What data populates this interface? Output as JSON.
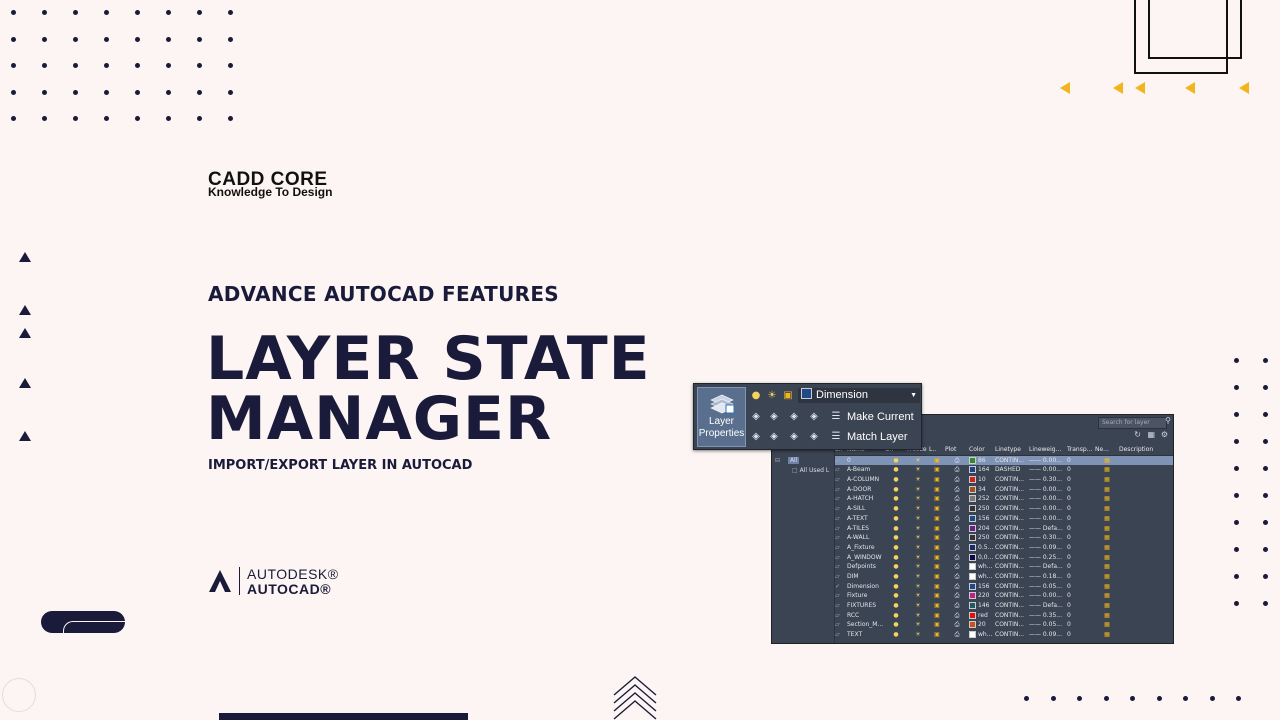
{
  "brand": {
    "name": "CADD CORE",
    "tagline": "Knowledge To Design"
  },
  "headline": {
    "kicker": "ADVANCE AUTOCAD FEATURES",
    "title_line1": "LAYER STATE",
    "title_line2": "MANAGER",
    "subtitle": "IMPORT/EXPORT LAYER IN AUTOCAD"
  },
  "autodesk": {
    "line1": "AUTODESK®",
    "line2": "AUTOCAD®"
  },
  "ribbon": {
    "layer_properties_label_1": "Layer",
    "layer_properties_label_2": "Properties",
    "current_layer": "Dimension",
    "make_current_label": "Make Current",
    "match_layer_label": "Match Layer"
  },
  "layer_manager": {
    "search_placeholder": "Search for layer",
    "tree": {
      "all": "All",
      "all_used": "All Used L"
    },
    "columns": [
      "S..",
      "Name",
      "O..",
      "Freeze",
      "L..",
      "Plot",
      "Color",
      "Linetype",
      "Lineweig...",
      "Transp...",
      "Ne...",
      "Description"
    ],
    "rows": [
      {
        "name": "0",
        "color": "86",
        "swatch": "#2e8b2e",
        "linetype": "CONTIN...",
        "lineweight": "—— 0.00...",
        "transparency": "0",
        "selected": true
      },
      {
        "name": "A-Beam",
        "color": "164",
        "swatch": "#1f3f8f",
        "linetype": "DASHED",
        "lineweight": "—— 0.00...",
        "transparency": "0"
      },
      {
        "name": "A-COLUMN",
        "color": "10",
        "swatch": "#d22020",
        "linetype": "CONTIN...",
        "lineweight": "—— 0.30...",
        "transparency": "0"
      },
      {
        "name": "A-DOOR",
        "color": "34",
        "swatch": "#a0521e",
        "linetype": "CONTIN...",
        "lineweight": "—— 0.00...",
        "transparency": "0"
      },
      {
        "name": "A-HATCH",
        "color": "252",
        "swatch": "#777777",
        "linetype": "CONTIN...",
        "lineweight": "—— 0.00...",
        "transparency": "0"
      },
      {
        "name": "A-SILL",
        "color": "250",
        "swatch": "#333333",
        "linetype": "CONTIN...",
        "lineweight": "—— 0.00...",
        "transparency": "0"
      },
      {
        "name": "A-TEXT",
        "color": "156",
        "swatch": "#1e4a8a",
        "linetype": "CONTIN...",
        "lineweight": "—— 0.00...",
        "transparency": "0"
      },
      {
        "name": "A-TILES",
        "color": "204",
        "swatch": "#6a1f8a",
        "linetype": "CONTIN...",
        "lineweight": "—— Defa...",
        "transparency": "0"
      },
      {
        "name": "A-WALL",
        "color": "250",
        "swatch": "#333333",
        "linetype": "CONTIN...",
        "lineweight": "—— 0.30...",
        "transparency": "0"
      },
      {
        "name": "A_Fixture",
        "color": "0.5...",
        "swatch": "#1a2a6a",
        "linetype": "CONTIN...",
        "lineweight": "—— 0.09...",
        "transparency": "0"
      },
      {
        "name": "A_WINDOW",
        "color": "0,0...",
        "swatch": "#0a0a4a",
        "linetype": "CONTIN...",
        "lineweight": "—— 0.25...",
        "transparency": "0"
      },
      {
        "name": "Defpoints",
        "color": "wh...",
        "swatch": "#ffffff",
        "linetype": "CONTIN...",
        "lineweight": "—— Defa...",
        "transparency": "0"
      },
      {
        "name": "DIM",
        "color": "wh...",
        "swatch": "#ffffff",
        "linetype": "CONTIN...",
        "lineweight": "—— 0.18...",
        "transparency": "0"
      },
      {
        "name": "Dimension",
        "color": "156",
        "swatch": "#1e4a8a",
        "linetype": "CONTIN...",
        "lineweight": "—— 0.05...",
        "transparency": "0",
        "current": true
      },
      {
        "name": "Fixture",
        "color": "220",
        "swatch": "#c0208a",
        "linetype": "CONTIN...",
        "lineweight": "—— 0.00...",
        "transparency": "0"
      },
      {
        "name": "FIXTURES",
        "color": "146",
        "swatch": "#1e5a6a",
        "linetype": "CONTIN...",
        "lineweight": "—— Defa...",
        "transparency": "0"
      },
      {
        "name": "RCC",
        "color": "red",
        "swatch": "#e01010",
        "linetype": "CONTIN...",
        "lineweight": "—— 0.35...",
        "transparency": "0"
      },
      {
        "name": "Section_M...",
        "color": "20",
        "swatch": "#d0501a",
        "linetype": "CONTIN...",
        "lineweight": "—— 0.05...",
        "transparency": "0"
      },
      {
        "name": "TEXT",
        "color": "wh...",
        "swatch": "#ffffff",
        "linetype": "CONTIN...",
        "lineweight": "—— 0.09...",
        "transparency": "0"
      }
    ]
  },
  "colors": {
    "navy": "#1a1b3a",
    "accent_yellow": "#f2b51c",
    "background": "#fcf5f3"
  }
}
